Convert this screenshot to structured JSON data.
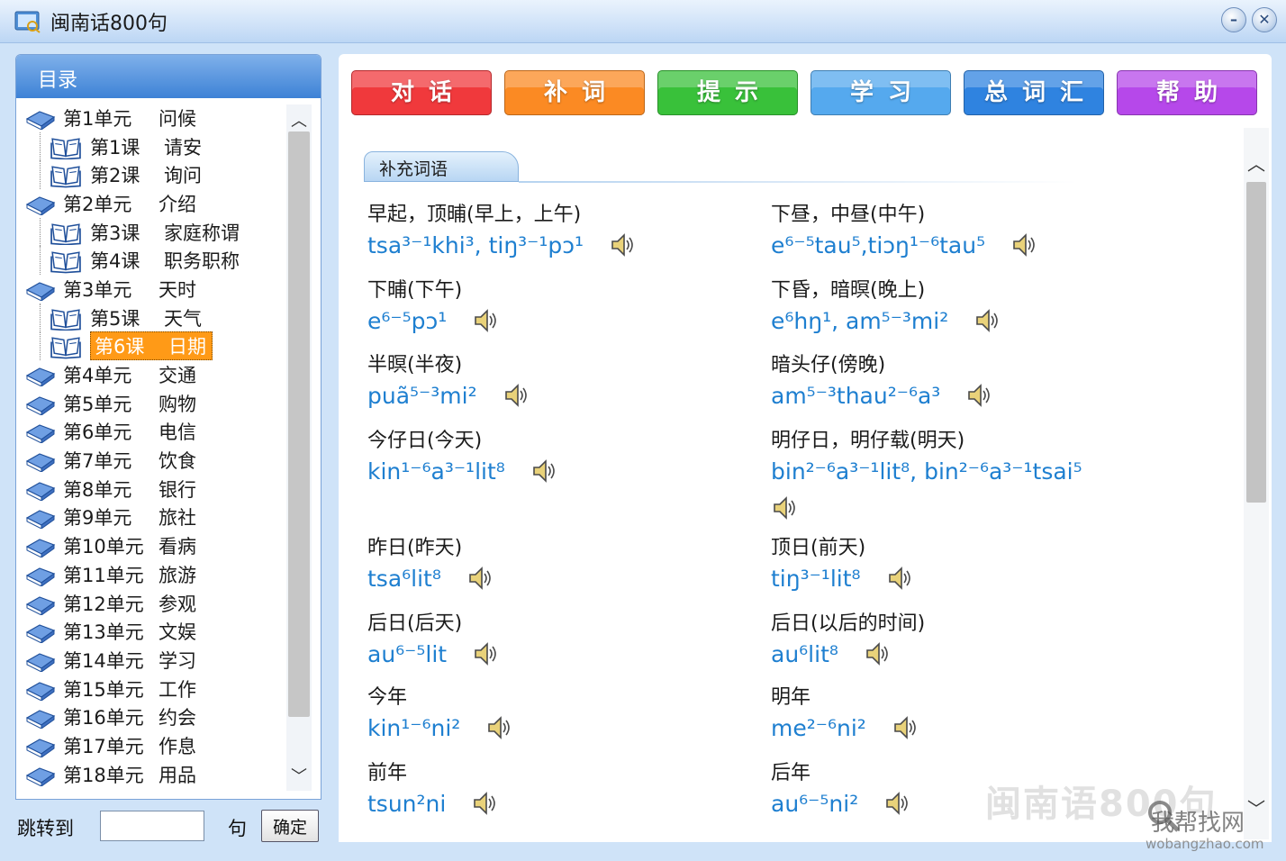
{
  "window": {
    "title": "闽南话800句"
  },
  "sidebar": {
    "header": "目录",
    "items": [
      {
        "type": "unit",
        "num": "第1单元",
        "name": "问候"
      },
      {
        "type": "lesson",
        "num": "第1课",
        "name": "请安"
      },
      {
        "type": "lesson",
        "num": "第2课",
        "name": "询问"
      },
      {
        "type": "unit",
        "num": "第2单元",
        "name": "介绍"
      },
      {
        "type": "lesson",
        "num": "第3课",
        "name": "家庭称谓"
      },
      {
        "type": "lesson",
        "num": "第4课",
        "name": "职务职称"
      },
      {
        "type": "unit",
        "num": "第3单元",
        "name": "天时"
      },
      {
        "type": "lesson",
        "num": "第5课",
        "name": "天气"
      },
      {
        "type": "lesson",
        "num": "第6课",
        "name": "日期",
        "selected": true
      },
      {
        "type": "unit",
        "num": "第4单元",
        "name": "交通"
      },
      {
        "type": "unit",
        "num": "第5单元",
        "name": "购物"
      },
      {
        "type": "unit",
        "num": "第6单元",
        "name": "电信"
      },
      {
        "type": "unit",
        "num": "第7单元",
        "name": "饮食"
      },
      {
        "type": "unit",
        "num": "第8单元",
        "name": "银行"
      },
      {
        "type": "unit",
        "num": "第9单元",
        "name": "旅社"
      },
      {
        "type": "unit",
        "num": "第10单元",
        "name": "看病"
      },
      {
        "type": "unit",
        "num": "第11单元",
        "name": "旅游"
      },
      {
        "type": "unit",
        "num": "第12单元",
        "name": "参观"
      },
      {
        "type": "unit",
        "num": "第13单元",
        "name": "文娱"
      },
      {
        "type": "unit",
        "num": "第14单元",
        "name": "学习"
      },
      {
        "type": "unit",
        "num": "第15单元",
        "name": "工作"
      },
      {
        "type": "unit",
        "num": "第16单元",
        "name": "约会"
      },
      {
        "type": "unit",
        "num": "第17单元",
        "name": "作息"
      },
      {
        "type": "unit",
        "num": "第18单元",
        "name": "用品"
      }
    ],
    "jump": {
      "label": "跳转到",
      "value": "",
      "unit": "句",
      "button": "确定"
    }
  },
  "toolbar": {
    "buttons": [
      {
        "label": "对话",
        "color": "#f0393c"
      },
      {
        "label": "补词",
        "color": "#fb8a23"
      },
      {
        "label": "提示",
        "color": "#39c13a"
      },
      {
        "label": "学习",
        "color": "#55a9ee"
      },
      {
        "label": "总词汇",
        "color": "#2f83e0"
      },
      {
        "label": "帮助",
        "color": "#b648ea"
      }
    ]
  },
  "content": {
    "section_title": "补充词语",
    "entries": [
      {
        "zh": "早起，顶晡(早上，上午)",
        "py": "tsa³⁻¹khi³, tiŋ³⁻¹pɔ¹"
      },
      {
        "zh": "下昼，中昼(中午)",
        "py": "e⁶⁻⁵tau⁵,tiɔŋ¹⁻⁶tau⁵"
      },
      {
        "zh": "下晡(下午)",
        "py": "e⁶⁻⁵pɔ¹"
      },
      {
        "zh": "下昏，暗暝(晚上)",
        "py": "e⁶hŋ¹, am⁵⁻³mi²"
      },
      {
        "zh": "半暝(半夜)",
        "py": "puã⁵⁻³mi²"
      },
      {
        "zh": "暗头仔(傍晚)",
        "py": "am⁵⁻³thau²⁻⁶a³"
      },
      {
        "zh": "今仔日(今天)",
        "py": "kin¹⁻⁶a³⁻¹lit⁸"
      },
      {
        "zh": "明仔日，明仔载(明天)",
        "py": "bin²⁻⁶a³⁻¹lit⁸, bin²⁻⁶a³⁻¹tsai⁵"
      },
      {
        "zh": "昨日(昨天)",
        "py": "tsa⁶lit⁸"
      },
      {
        "zh": "顶日(前天)",
        "py": "tiŋ³⁻¹lit⁸"
      },
      {
        "zh": "后日(后天)",
        "py": "au⁶⁻⁵lit"
      },
      {
        "zh": "后日(以后的时间)",
        "py": "au⁶lit⁸"
      },
      {
        "zh": "今年",
        "py": "kin¹⁻⁶ni²"
      },
      {
        "zh": "明年",
        "py": "me²⁻⁶ni²"
      },
      {
        "zh": "前年",
        "py": "tsun²ni"
      },
      {
        "zh": "后年",
        "py": "au⁶⁻⁵ni²"
      }
    ]
  },
  "watermark": {
    "text1": "闽南语800句",
    "text2": "我帮找网",
    "text3": "wobangzhao.com"
  }
}
